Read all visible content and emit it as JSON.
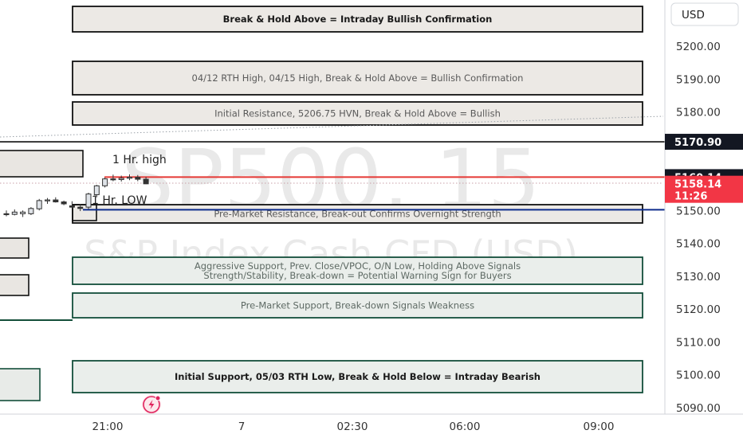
{
  "chart_data": {
    "type": "candlestick",
    "symbol": "SP500, 15",
    "instrument": "S&P Index Cash CFD (USD)",
    "currency": "USD",
    "y_ticks": [
      5200,
      5190,
      5180,
      5150,
      5140,
      5130,
      5120,
      5110,
      5100,
      5090
    ],
    "y_tick_labels": [
      "5200.00",
      "5190.00",
      "5180.00",
      "5150.00",
      "5140.00",
      "5130.00",
      "5120.00",
      "5110.00",
      "5100.00",
      "5090.00"
    ],
    "x_ticks": [
      "21:00",
      "7",
      "02:30",
      "06:00",
      "09:00"
    ],
    "price_tags": [
      {
        "label": "5170.90",
        "style": "dark"
      },
      {
        "label": "5160.14",
        "style": "dark"
      },
      {
        "label": "5158.14",
        "sub": "11:26",
        "style": "red"
      }
    ],
    "zones": [
      {
        "label": "Break & Hold Above = Intraday Bullish Confirmation",
        "kind": "resistance-strong",
        "lines": 1
      },
      {
        "label": "04/12 RTH High, 04/15 High, Break & Hold Above = Bullish Confirmation",
        "kind": "resistance",
        "lines": 1
      },
      {
        "label": "Initial Resistance, 5206.75 HVN, Break & Hold Above = Bullish",
        "kind": "resistance",
        "lines": 1
      },
      {
        "label": "Pre-Market Resistance, Break-out Confirms Overnight Strength",
        "kind": "resistance",
        "lines": 1
      },
      {
        "label": "Aggressive Support, Prev. Close/VPOC, O/N Low, Holding Above Signals",
        "label2": "Strength/Stability, Break-down = Potential Warning Sign for Buyers",
        "kind": "support",
        "lines": 2
      },
      {
        "label": "Pre-Market Support, Break-down Signals Weakness",
        "kind": "support",
        "lines": 1
      },
      {
        "label": "Initial Support, 05/03 RTH Low, Break & Hold Below = Intraday Bearish",
        "kind": "support-strong",
        "lines": 1
      }
    ],
    "annotations": [
      "1 Hr. high",
      "1 Hr. LOW"
    ],
    "levels": [
      {
        "name": "1 Hr. high",
        "value": 5160.14,
        "color": "#e53935"
      },
      {
        "name": "1 Hr. LOW",
        "value": 5150.2,
        "color": "#0d2c8c"
      },
      {
        "name": "level-5170.90",
        "value": 5170.9,
        "color": "#111111"
      }
    ],
    "candles": [
      {
        "o": 5149.0,
        "h": 5150.0,
        "l": 5148.2,
        "c": 5148.8
      },
      {
        "o": 5148.8,
        "h": 5150.3,
        "l": 5148.5,
        "c": 5149.5
      },
      {
        "o": 5149.0,
        "h": 5150.0,
        "l": 5148.0,
        "c": 5149.5
      },
      {
        "o": 5149.0,
        "h": 5151.0,
        "l": 5148.6,
        "c": 5150.6
      },
      {
        "o": 5150.5,
        "h": 5153.5,
        "l": 5150.0,
        "c": 5153.0
      },
      {
        "o": 5153.0,
        "h": 5153.8,
        "l": 5152.0,
        "c": 5153.2
      },
      {
        "o": 5153.2,
        "h": 5154.0,
        "l": 5152.4,
        "c": 5152.6
      },
      {
        "o": 5152.6,
        "h": 5153.0,
        "l": 5151.6,
        "c": 5152.0
      },
      {
        "o": 5151.4,
        "h": 5152.8,
        "l": 5150.6,
        "c": 5151.0
      },
      {
        "o": 5151.0,
        "h": 5152.0,
        "l": 5149.8,
        "c": 5150.6
      },
      {
        "o": 5151.0,
        "h": 5155.4,
        "l": 5150.4,
        "c": 5155.0
      },
      {
        "o": 5154.8,
        "h": 5157.8,
        "l": 5154.0,
        "c": 5157.5
      },
      {
        "o": 5157.5,
        "h": 5160.0,
        "l": 5157.0,
        "c": 5159.6
      },
      {
        "o": 5159.6,
        "h": 5160.9,
        "l": 5158.9,
        "c": 5159.4
      },
      {
        "o": 5159.4,
        "h": 5160.6,
        "l": 5158.8,
        "c": 5159.8
      },
      {
        "o": 5159.8,
        "h": 5161.0,
        "l": 5159.2,
        "c": 5160.1
      },
      {
        "o": 5160.1,
        "h": 5160.8,
        "l": 5158.9,
        "c": 5159.5
      },
      {
        "o": 5159.5,
        "h": 5160.2,
        "l": 5158.0,
        "c": 5158.1
      }
    ]
  }
}
